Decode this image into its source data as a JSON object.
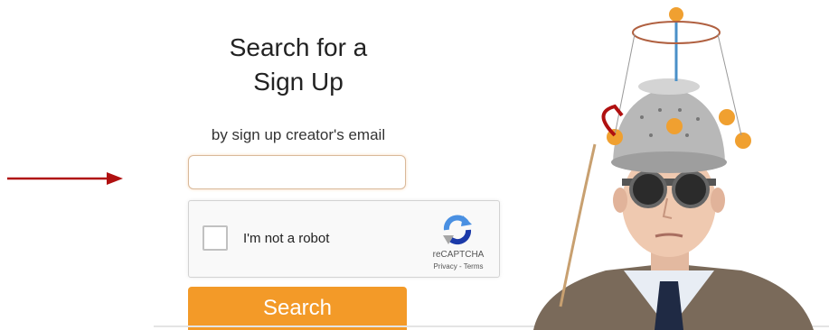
{
  "form": {
    "title_line1": "Search for a",
    "title_line2": "Sign Up",
    "subtitle": "by sign up creator's email",
    "email_value": "",
    "submit_label": "Search"
  },
  "recaptcha": {
    "checkbox_label": "I'm not a robot",
    "brand": "reCAPTCHA",
    "privacy_label": "Privacy",
    "separator": " - ",
    "terms_label": "Terms"
  },
  "colors": {
    "accent": "#f39a28",
    "arrow": "#b01010",
    "input_border": "#d9b99a"
  },
  "icons": [
    "arrow-right-icon",
    "recaptcha-logo-icon",
    "mind-reader-mascot-illustration"
  ]
}
